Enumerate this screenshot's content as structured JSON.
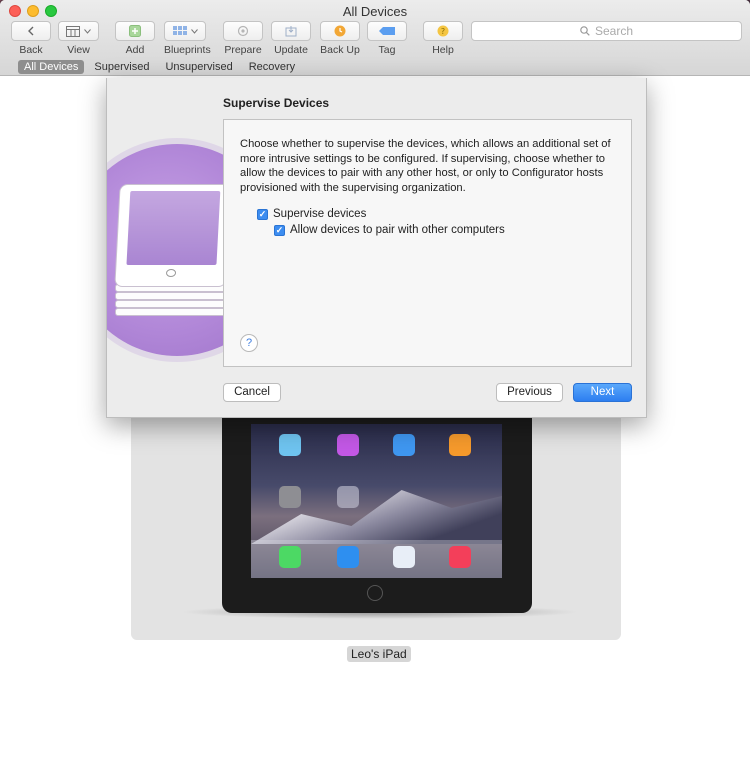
{
  "window": {
    "title": "All Devices"
  },
  "toolbar": {
    "back": "Back",
    "view": "View",
    "add": "Add",
    "blueprints": "Blueprints",
    "prepare": "Prepare",
    "update": "Update",
    "backup": "Back Up",
    "tag": "Tag",
    "help": "Help",
    "search_placeholder": "Search"
  },
  "filters": [
    "All Devices",
    "Supervised",
    "Unsupervised",
    "Recovery"
  ],
  "device": {
    "name": "Leo's iPad"
  },
  "sheet": {
    "title": "Supervise Devices",
    "description": "Choose whether to supervise the devices, which allows an additional set of more intrusive settings to be configured. If supervising, choose whether to allow the devices to pair with any other host, or only to Configurator hosts provisioned with the supervising organization.",
    "supervise_label": "Supervise devices",
    "supervise_checked": true,
    "pair_label": "Allow devices to pair with other computers",
    "pair_checked": true,
    "help_glyph": "?",
    "cancel": "Cancel",
    "previous": "Previous",
    "next": "Next"
  },
  "colors": {
    "accent": "#3d8df0",
    "art": "#b187d8"
  }
}
